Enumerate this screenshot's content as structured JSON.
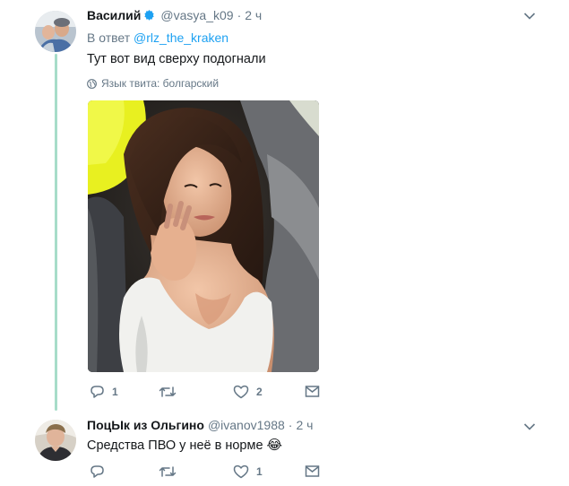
{
  "tweets": [
    {
      "author": "Василий",
      "handle": "@vasya_k09",
      "time": "2 ч",
      "reply_prefix": "В ответ",
      "reply_mention": "@rlz_the_kraken",
      "text": "Тут вот вид сверху подогнали",
      "translate": "Язык твита: болгарский",
      "actions": {
        "reply_count": "1",
        "retweet_count": "",
        "like_count": "2"
      }
    },
    {
      "author": "ПоцЫк из Ольгино",
      "handle": "@ivanov1988",
      "time": "2 ч",
      "text": "Средства ПВО у неё в норме",
      "emoji": "😂",
      "actions": {
        "reply_count": "",
        "retweet_count": "",
        "like_count": "1"
      }
    }
  ],
  "separator": "·",
  "colors": {
    "name": "#14171a",
    "meta": "#657786",
    "link": "#1da1f2",
    "thread_line": "#a7dcc9",
    "verified": "#1da1f2"
  },
  "icons": {
    "verified": "verified-badge-icon",
    "caret": "chevron-down-icon",
    "globe": "globe-icon",
    "reply": "reply-icon",
    "retweet": "retweet-icon",
    "like": "heart-icon",
    "dm": "envelope-icon"
  }
}
